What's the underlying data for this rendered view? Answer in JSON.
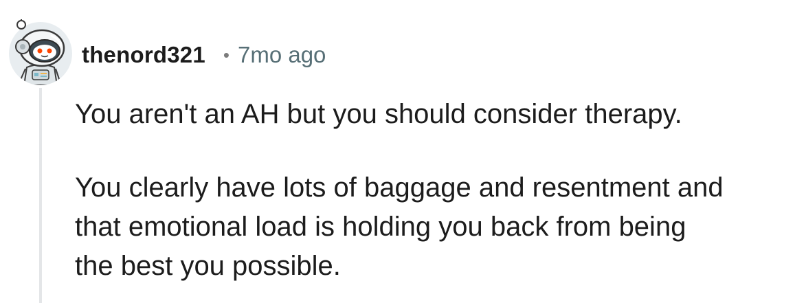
{
  "comment": {
    "username": "thenord321",
    "separator": "•",
    "timestamp": "7mo ago",
    "avatar_icon": "snoo-astronaut-avatar-icon",
    "paragraphs": [
      {
        "lines": [
          "You aren't an AH but you should consider therapy."
        ]
      },
      {
        "lines": [
          "You clearly have lots of baggage and resentment and",
          "that emotional load is holding you back from being",
          "the best you possible."
        ]
      }
    ]
  },
  "colors": {
    "thread_line": "#e4e6e8",
    "username": "#1c1c1c",
    "timestamp": "#576f76",
    "avatar_accent": "#ff4500"
  }
}
